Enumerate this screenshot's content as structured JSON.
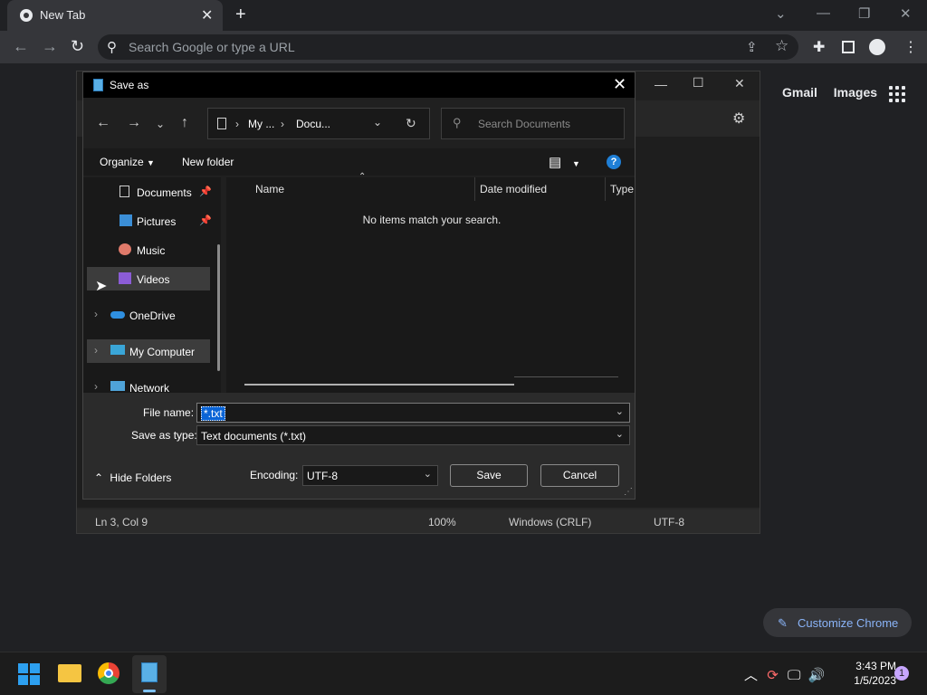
{
  "browser": {
    "tab_title": "New Tab",
    "omnibox_placeholder": "Search Google or type a URL",
    "ntp_links": [
      "Gmail",
      "Images"
    ],
    "customize_label": "Customize Chrome"
  },
  "notepad": {
    "status": {
      "position": "Ln 3, Col 9",
      "zoom": "100%",
      "line_ending": "Windows (CRLF)",
      "encoding": "UTF-8"
    }
  },
  "dialog": {
    "title": "Save as",
    "breadcrumb": [
      "My ...",
      "Docu..."
    ],
    "search_placeholder": "Search Documents",
    "organize_label": "Organize",
    "new_folder_label": "New folder",
    "nav_items": [
      {
        "label": "Documents",
        "icon": "documents-icon",
        "pinned": true
      },
      {
        "label": "Pictures",
        "icon": "pictures-icon",
        "pinned": true
      },
      {
        "label": "Music",
        "icon": "music-icon",
        "pinned": false
      },
      {
        "label": "Videos",
        "icon": "videos-icon",
        "pinned": false
      },
      {
        "label": "OneDrive",
        "icon": "onedrive-icon",
        "pinned": false
      },
      {
        "label": "My Computer",
        "icon": "computer-icon",
        "pinned": false
      },
      {
        "label": "Network",
        "icon": "network-icon",
        "pinned": false
      }
    ],
    "columns": [
      "Name",
      "Date modified",
      "Type"
    ],
    "empty_message": "No items match your search.",
    "file_name_label": "File name:",
    "file_name_value": "*.txt",
    "save_type_label": "Save as type:",
    "save_type_value": "Text documents (*.txt)",
    "hide_folders_label": "Hide Folders",
    "encoding_label": "Encoding:",
    "encoding_value": "UTF-8",
    "save_label": "Save",
    "cancel_label": "Cancel"
  },
  "taskbar": {
    "time": "3:43 PM",
    "date": "1/5/2023",
    "notification_count": "1"
  },
  "colors": {
    "accent": "#0a64d6",
    "chrome_link": "#8ab4f8"
  }
}
